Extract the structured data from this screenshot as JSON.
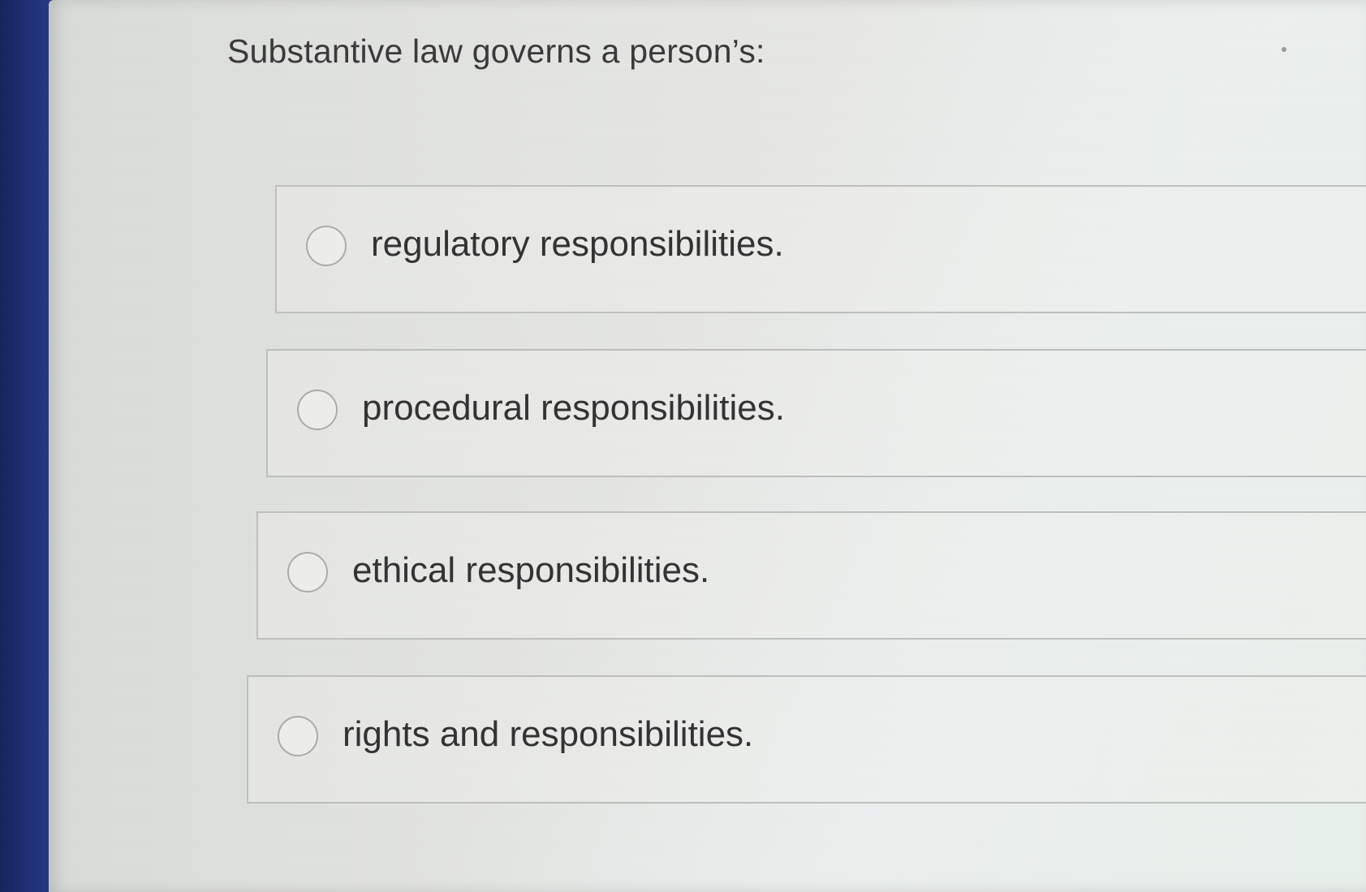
{
  "question": {
    "text": "Substantive law governs a person’s:"
  },
  "options": [
    {
      "label": "regulatory responsibilities."
    },
    {
      "label": "procedural responsibilities."
    },
    {
      "label": "ethical responsibilities."
    },
    {
      "label": "rights and responsibilities."
    }
  ]
}
